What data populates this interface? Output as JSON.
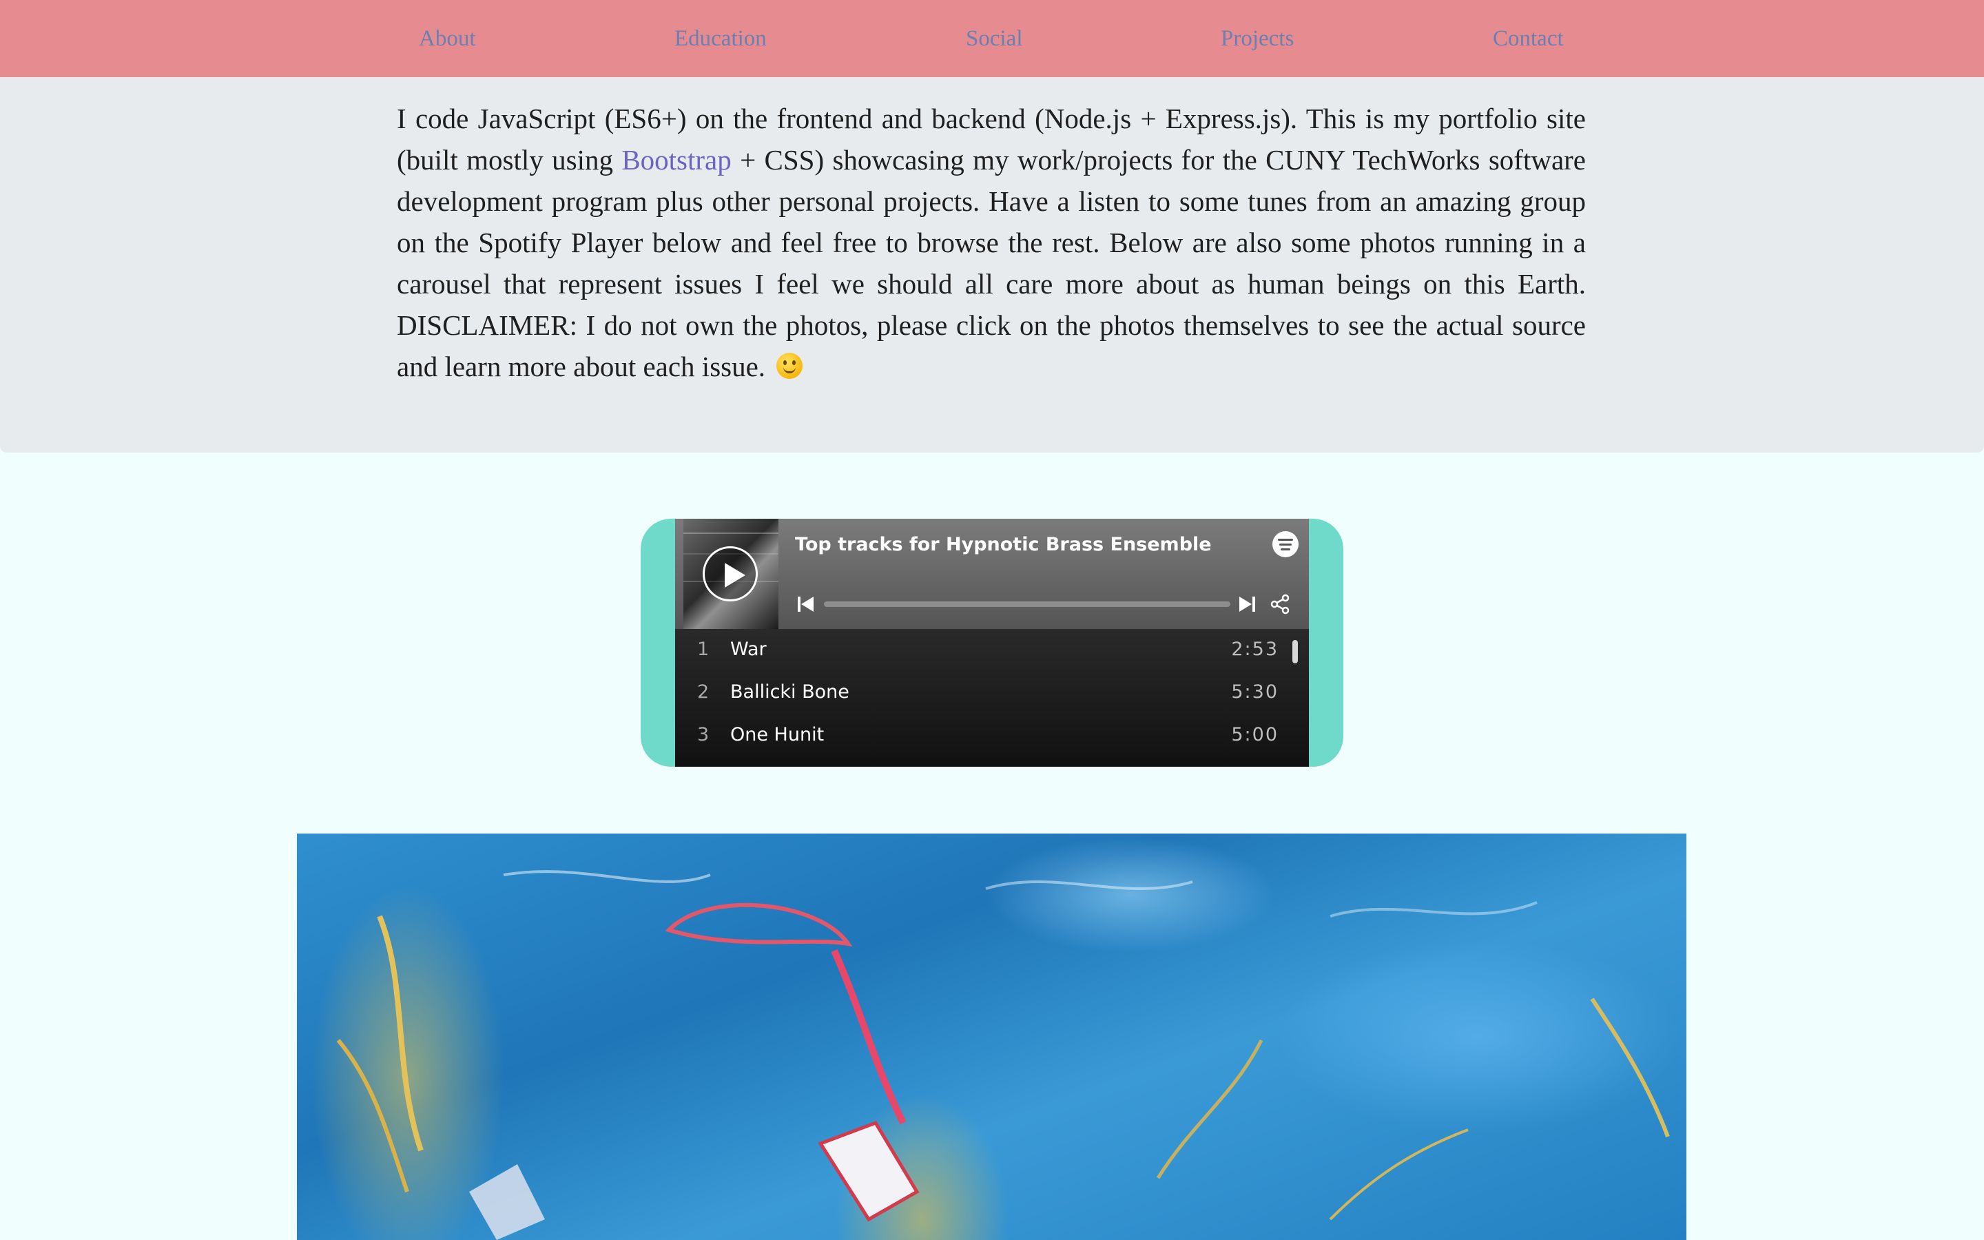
{
  "nav": {
    "items": [
      "About",
      "Education",
      "Social",
      "Projects",
      "Contact"
    ]
  },
  "intro": {
    "text_before_link": "I code JavaScript (ES6+) on the frontend and backend (Node.js + Express.js). This is my portfolio site (built mostly using ",
    "link_text": "Bootstrap",
    "text_after_link": " + CSS) showcasing my work/projects for the CUNY TechWorks software development program plus other personal projects. Have a listen to some tunes from an amazing group on the Spotify Player below and feel free to browse the rest. Below are also some photos running in a carousel that represent issues I feel we should all care more about as human beings on this Earth. DISCLAIMER: I do not own the photos, please click on the photos themselves to see the actual source and learn more about each issue."
  },
  "spotify": {
    "title": "Top tracks for Hypnotic Brass Ensemble",
    "tracks": [
      {
        "num": "1",
        "name": "War",
        "duration": "2:53"
      },
      {
        "num": "2",
        "name": "Ballicki Bone",
        "duration": "5:30"
      },
      {
        "num": "3",
        "name": "One Hunit",
        "duration": "5:00"
      }
    ],
    "icons": {
      "play": "play-icon",
      "prev": "skip-back-icon",
      "next": "skip-forward-icon",
      "share": "share-icon",
      "brand": "spotify-logo-icon"
    }
  },
  "colors": {
    "nav_bg": "#e68b8f",
    "nav_link": "#6a7fb2",
    "intro_bg": "#e8ebee",
    "link": "#6c63c2",
    "page_bg": "#f0fffe",
    "spotify_frame": "#6fdaca"
  }
}
